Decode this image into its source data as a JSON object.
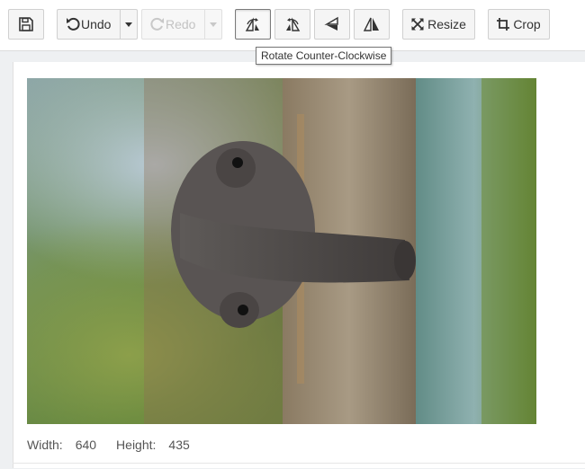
{
  "toolbar": {
    "undo_label": "Undo",
    "redo_label": "Redo",
    "resize_label": "Resize",
    "crop_label": "Crop",
    "redo_disabled": true
  },
  "tooltip": {
    "text": "Rotate Counter-Clockwise"
  },
  "image_info": {
    "width_label": "Width:",
    "width_value": "640",
    "height_label": "Height:",
    "height_value": "435"
  },
  "colors": {
    "accent": "#333333",
    "disabled": "#c3c3c3",
    "panel_bg": "#eef0f2"
  },
  "icons": {
    "save": "floppy-disk",
    "undo": "undo-arrow",
    "redo": "redo-arrow",
    "rotate_ccw": "rotate-counter-clockwise",
    "rotate_cw": "rotate-clockwise",
    "flip_vertical": "flip-vertical",
    "flip_horizontal": "flip-horizontal",
    "resize": "resize-arrows",
    "crop": "crop"
  }
}
